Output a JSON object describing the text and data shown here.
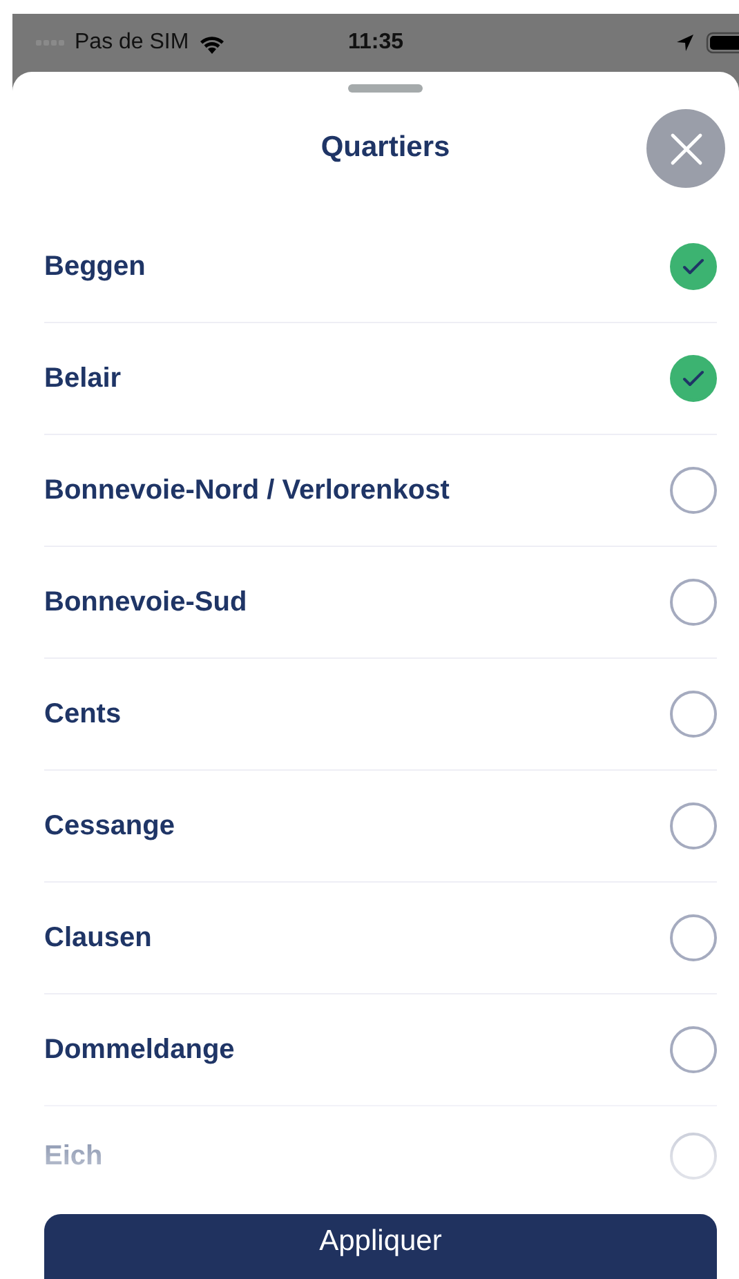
{
  "status_bar": {
    "carrier": "Pas de SIM",
    "time": "11:35"
  },
  "sheet": {
    "title": "Quartiers"
  },
  "items": [
    {
      "label": "Beggen",
      "checked": true
    },
    {
      "label": "Belair",
      "checked": true
    },
    {
      "label": "Bonnevoie-Nord / Verlorenkost",
      "checked": false
    },
    {
      "label": "Bonnevoie-Sud",
      "checked": false
    },
    {
      "label": "Cents",
      "checked": false
    },
    {
      "label": "Cessange",
      "checked": false
    },
    {
      "label": "Clausen",
      "checked": false
    },
    {
      "label": "Dommeldange",
      "checked": false
    },
    {
      "label": "Eich",
      "checked": false
    }
  ],
  "apply_button": "Appliquer"
}
